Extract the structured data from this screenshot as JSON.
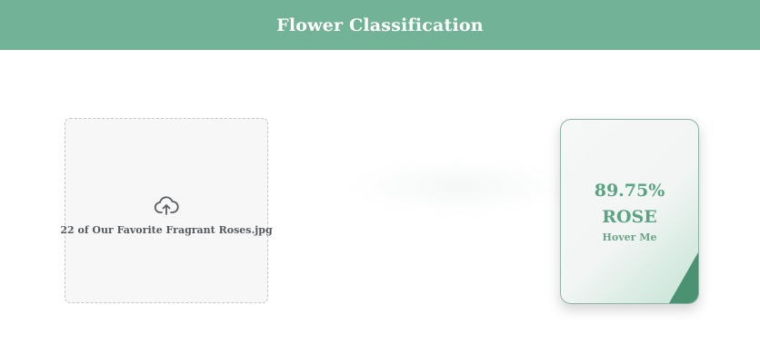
{
  "header": {
    "title": "Flower Classification"
  },
  "upload": {
    "icon": "cloud-upload-icon",
    "file_name": "22 of Our Favorite Fragrant Roses.jpg"
  },
  "result": {
    "confidence": "89.75%",
    "label": "ROSE",
    "hint": "Hover Me"
  },
  "colors": {
    "header_bg": "#72b296",
    "accent": "#5aa383",
    "corner": "#4a9272"
  }
}
